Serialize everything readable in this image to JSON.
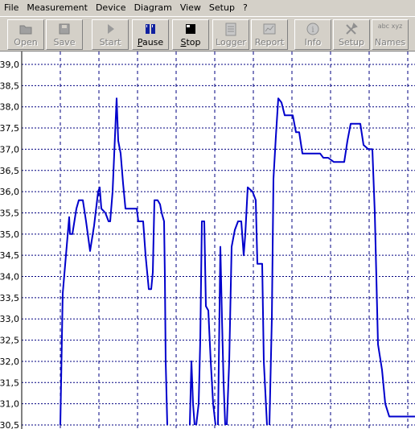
{
  "menu": [
    "File",
    "Measurement",
    "Device",
    "Diagram",
    "View",
    "Setup",
    "?"
  ],
  "toolbar": [
    {
      "label": "Open",
      "icon": "folder-icon",
      "enabled": false
    },
    {
      "label": "Save",
      "icon": "disk-icon",
      "enabled": false
    },
    {
      "label": "Start",
      "icon": "play-icon",
      "enabled": false
    },
    {
      "label": "Pause",
      "icon": "pause-icon",
      "enabled": true
    },
    {
      "label": "Stop",
      "icon": "stop-icon",
      "enabled": true
    },
    {
      "label": "Logger",
      "icon": "logger-icon",
      "enabled": false
    },
    {
      "label": "Report",
      "icon": "report-icon",
      "enabled": false
    },
    {
      "label": "Info",
      "icon": "info-icon",
      "enabled": false
    },
    {
      "label": "Setup",
      "icon": "tools-icon",
      "enabled": false
    },
    {
      "label": "Names",
      "icon": "names-icon",
      "icon_text": "abc xyz",
      "enabled": false
    }
  ],
  "chart_data": {
    "type": "line",
    "ylim": [
      30.5,
      39.0
    ],
    "yticks": [
      "39,0",
      "38,5",
      "38,0",
      "37,5",
      "37,0",
      "36,5",
      "36,0",
      "35,5",
      "35,0",
      "34,5",
      "34,0",
      "33,5",
      "33,0",
      "32,5",
      "32,0",
      "31,5",
      "31,0",
      "30,5"
    ],
    "grid": true,
    "line_color": "#0000cc",
    "series": [
      {
        "values": [
          [
            75,
            30.5
          ],
          [
            78,
            33.6
          ],
          [
            82,
            34.5
          ],
          [
            86,
            35.4
          ],
          [
            87,
            35.0
          ],
          [
            90,
            35.0
          ],
          [
            95,
            35.6
          ],
          [
            98,
            35.8
          ],
          [
            103,
            35.8
          ],
          [
            107,
            35.3
          ],
          [
            112,
            34.6
          ],
          [
            117,
            35.2
          ],
          [
            122,
            36.0
          ],
          [
            124,
            36.1
          ],
          [
            126,
            35.6
          ],
          [
            131,
            35.5
          ],
          [
            135,
            35.3
          ],
          [
            137,
            35.3
          ],
          [
            140,
            36.0
          ],
          [
            145,
            38.2
          ],
          [
            147,
            37.2
          ],
          [
            150,
            36.9
          ],
          [
            153,
            36.2
          ],
          [
            156,
            35.6
          ],
          [
            165,
            35.6
          ],
          [
            170,
            35.6
          ],
          [
            172,
            35.3
          ],
          [
            178,
            35.3
          ],
          [
            181,
            34.5
          ],
          [
            185,
            33.7
          ],
          [
            188,
            33.7
          ],
          [
            190,
            34.1
          ],
          [
            192,
            35.8
          ],
          [
            196,
            35.8
          ],
          [
            199,
            35.7
          ],
          [
            201,
            35.5
          ],
          [
            204,
            35.3
          ],
          [
            205,
            34.0
          ],
          [
            206,
            32.0
          ],
          [
            208,
            30.5
          ]
        ]
      },
      {
        "values": [
          [
            236,
            30.5
          ],
          [
            238,
            32.0
          ],
          [
            240,
            31.0
          ],
          [
            242,
            30.5
          ]
        ]
      },
      {
        "values": [
          [
            244,
            30.5
          ],
          [
            247,
            31.0
          ],
          [
            249,
            32.5
          ],
          [
            251,
            35.3
          ],
          [
            254,
            35.3
          ],
          [
            256,
            33.3
          ],
          [
            259,
            33.2
          ],
          [
            262,
            32.0
          ],
          [
            265,
            31.0
          ],
          [
            268,
            30.5
          ]
        ]
      },
      {
        "values": [
          [
            271,
            30.5
          ],
          [
            274,
            34.7
          ],
          [
            276,
            33.0
          ],
          [
            278,
            31.5
          ],
          [
            280,
            30.5
          ]
        ]
      },
      {
        "values": [
          [
            282,
            30.5
          ],
          [
            285,
            32.0
          ],
          [
            288,
            34.7
          ],
          [
            292,
            35.1
          ],
          [
            296,
            35.3
          ],
          [
            300,
            35.3
          ],
          [
            303,
            34.5
          ],
          [
            305,
            35.0
          ],
          [
            308,
            36.1
          ],
          [
            314,
            36.0
          ],
          [
            318,
            35.8
          ],
          [
            320,
            34.3
          ],
          [
            326,
            34.3
          ],
          [
            328,
            32.0
          ],
          [
            332,
            30.5
          ]
        ]
      },
      {
        "values": [
          [
            335,
            30.5
          ],
          [
            338,
            33.0
          ],
          [
            340,
            36.3
          ],
          [
            343,
            37.3
          ],
          [
            346,
            38.2
          ],
          [
            350,
            38.1
          ],
          [
            354,
            37.8
          ],
          [
            364,
            37.8
          ],
          [
            368,
            37.4
          ],
          [
            372,
            37.4
          ],
          [
            376,
            36.9
          ],
          [
            398,
            36.9
          ],
          [
            402,
            36.8
          ],
          [
            408,
            36.8
          ],
          [
            415,
            36.7
          ],
          [
            428,
            36.7
          ],
          [
            432,
            37.2
          ],
          [
            436,
            37.6
          ],
          [
            448,
            37.6
          ],
          [
            452,
            37.1
          ],
          [
            458,
            37.0
          ],
          [
            463,
            37.0
          ],
          [
            466,
            35.5
          ],
          [
            470,
            32.4
          ],
          [
            475,
            31.8
          ],
          [
            479,
            31.0
          ],
          [
            484,
            30.7
          ],
          [
            516,
            30.7
          ]
        ]
      }
    ]
  }
}
